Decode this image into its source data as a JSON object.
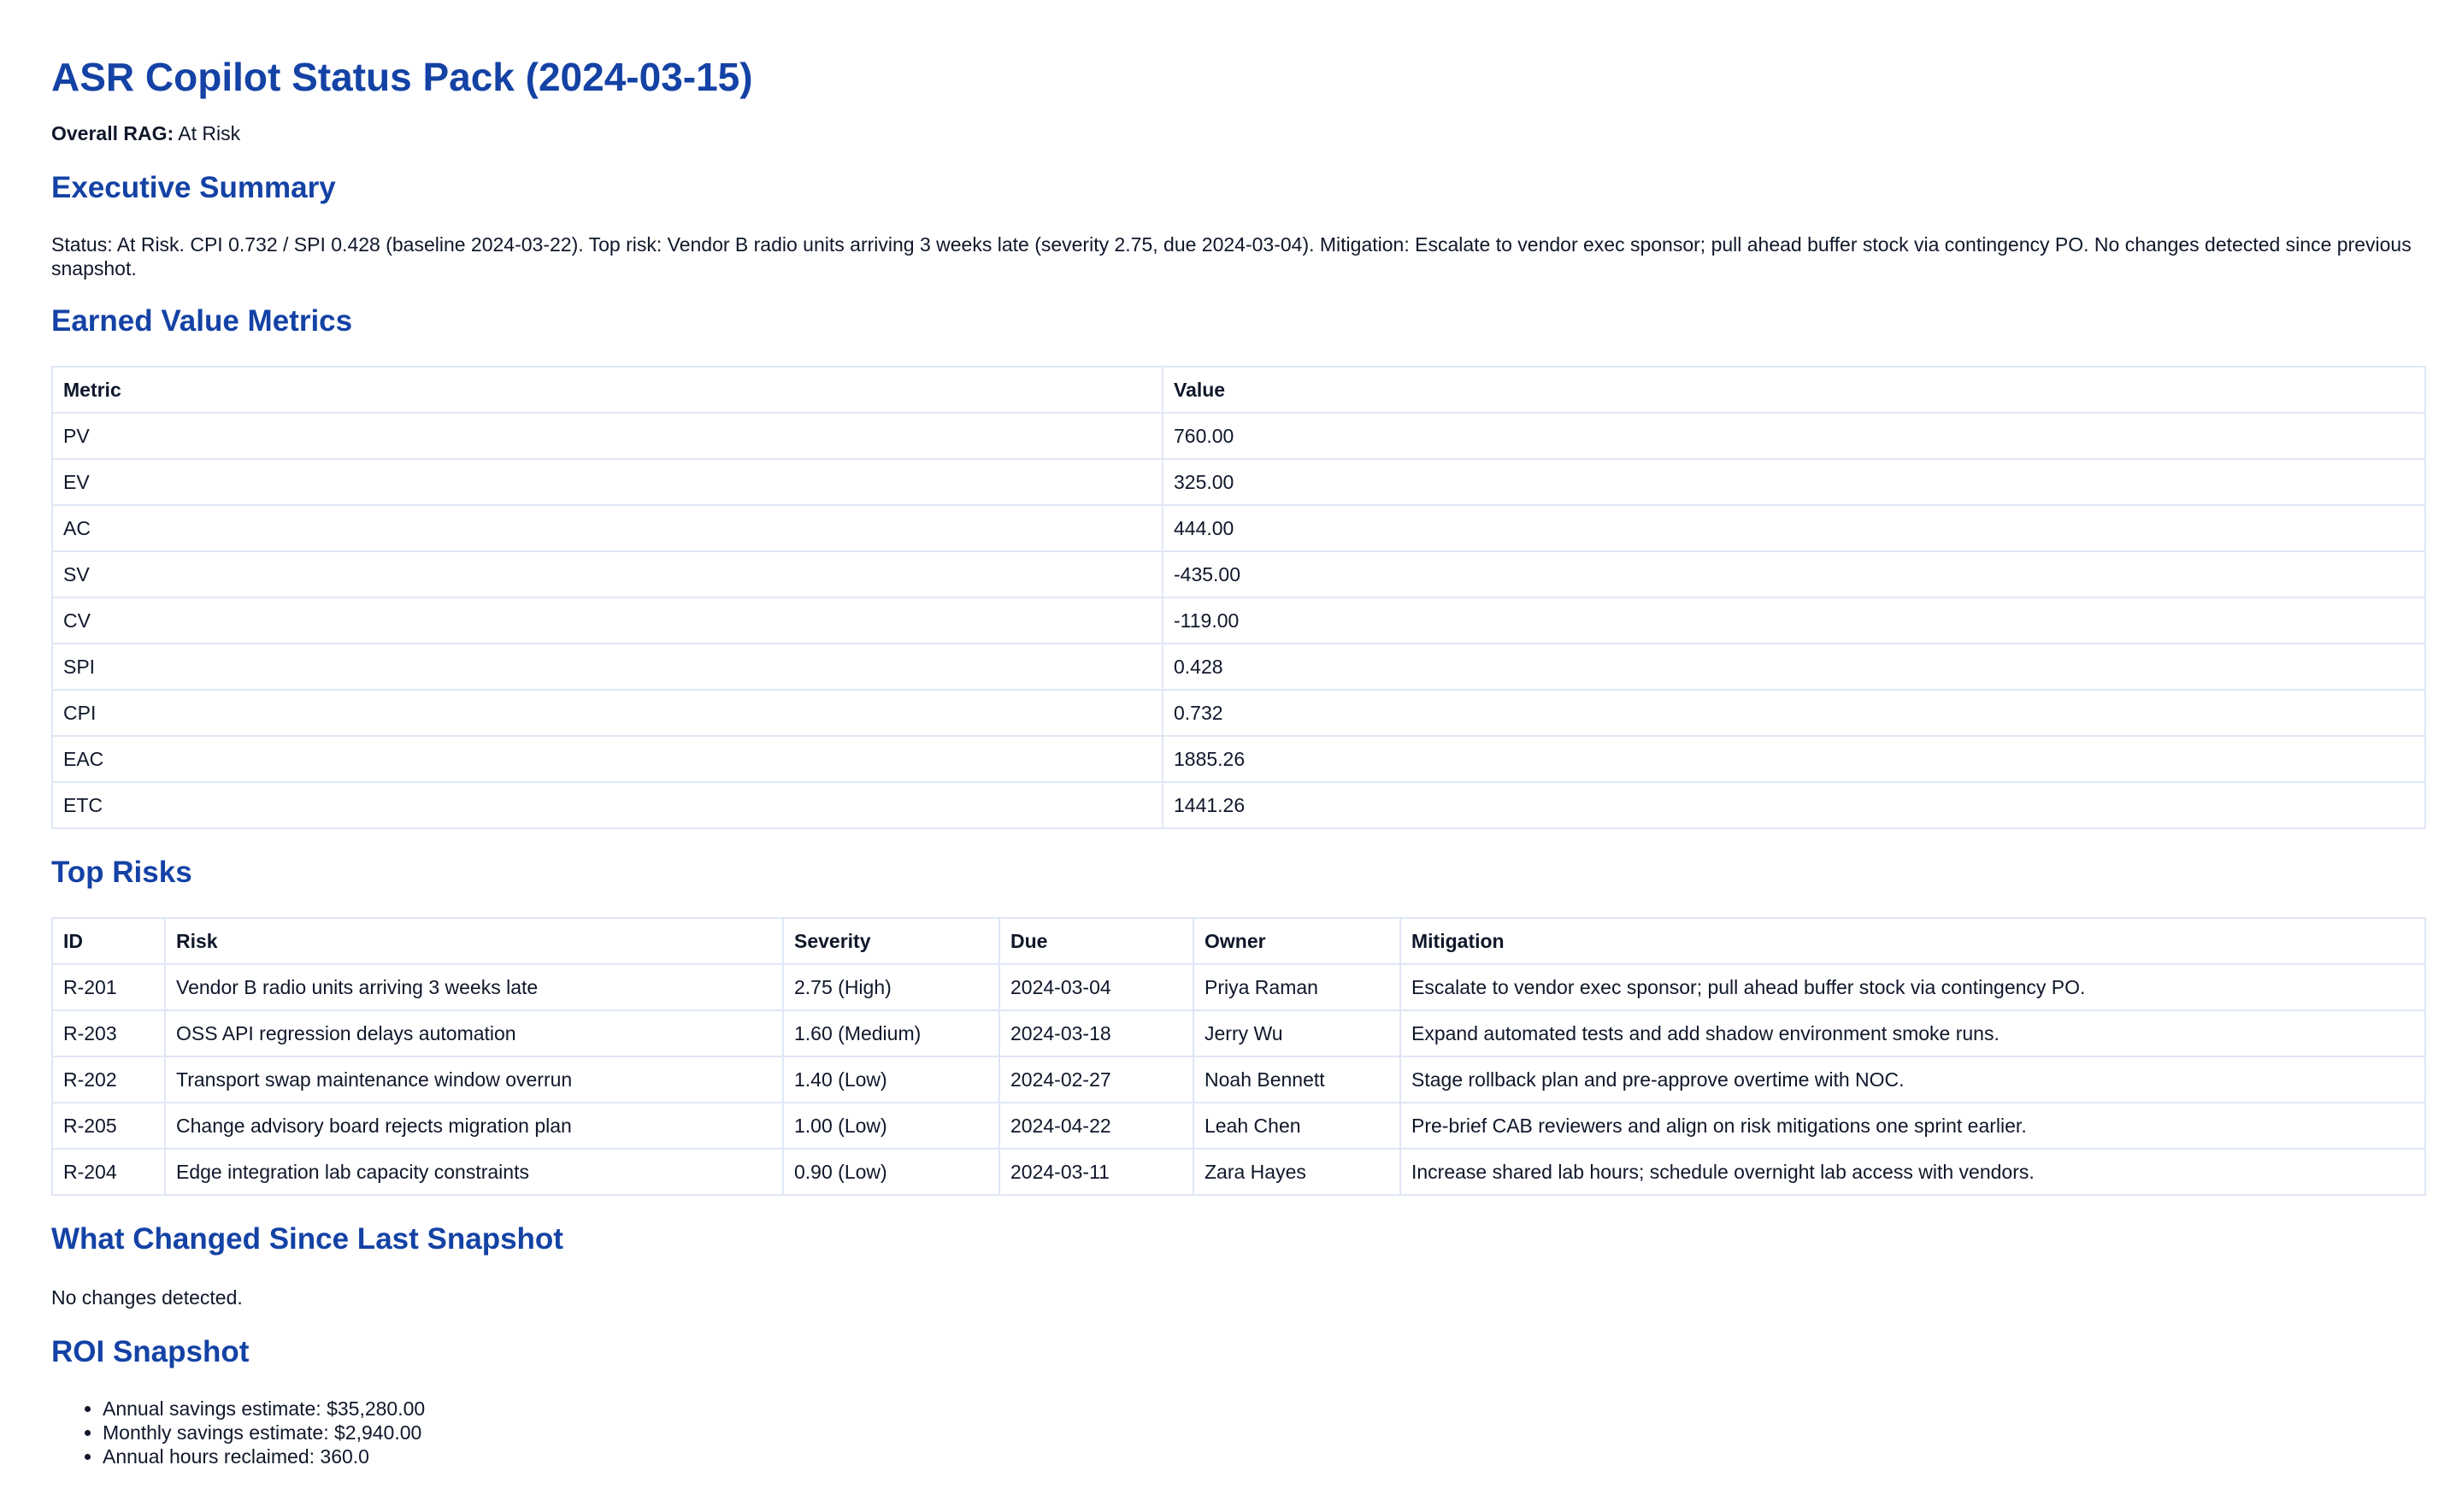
{
  "title": "ASR Copilot Status Pack (2024-03-15)",
  "overall_rag": {
    "label": "Overall RAG:",
    "value": "At Risk"
  },
  "executive_summary": {
    "heading": "Executive Summary",
    "text": "Status: At Risk. CPI 0.732 / SPI 0.428 (baseline 2024-03-22). Top risk: Vendor B radio units arriving 3 weeks late (severity 2.75, due 2024-03-04). Mitigation: Escalate to vendor exec sponsor; pull ahead buffer stock via contingency PO. No changes detected since previous snapshot."
  },
  "earned_value": {
    "heading": "Earned Value Metrics",
    "columns": [
      "Metric",
      "Value"
    ],
    "rows": [
      [
        "PV",
        "760.00"
      ],
      [
        "EV",
        "325.00"
      ],
      [
        "AC",
        "444.00"
      ],
      [
        "SV",
        "-435.00"
      ],
      [
        "CV",
        "-119.00"
      ],
      [
        "SPI",
        "0.428"
      ],
      [
        "CPI",
        "0.732"
      ],
      [
        "EAC",
        "1885.26"
      ],
      [
        "ETC",
        "1441.26"
      ]
    ]
  },
  "top_risks": {
    "heading": "Top Risks",
    "columns": [
      "ID",
      "Risk",
      "Severity",
      "Due",
      "Owner",
      "Mitigation"
    ],
    "rows": [
      [
        "R-201",
        "Vendor B radio units arriving 3 weeks late",
        "2.75 (High)",
        "2024-03-04",
        "Priya Raman",
        "Escalate to vendor exec sponsor; pull ahead buffer stock via contingency PO."
      ],
      [
        "R-203",
        "OSS API regression delays automation",
        "1.60 (Medium)",
        "2024-03-18",
        "Jerry Wu",
        "Expand automated tests and add shadow environment smoke runs."
      ],
      [
        "R-202",
        "Transport swap maintenance window overrun",
        "1.40 (Low)",
        "2024-02-27",
        "Noah Bennett",
        "Stage rollback plan and pre-approve overtime with NOC."
      ],
      [
        "R-205",
        "Change advisory board rejects migration plan",
        "1.00 (Low)",
        "2024-04-22",
        "Leah Chen",
        "Pre-brief CAB reviewers and align on risk mitigations one sprint earlier."
      ],
      [
        "R-204",
        "Edge integration lab capacity constraints",
        "0.90 (Low)",
        "2024-03-11",
        "Zara Hayes",
        "Increase shared lab hours; schedule overnight lab access with vendors."
      ]
    ]
  },
  "changes": {
    "heading": "What Changed Since Last Snapshot",
    "text": "No changes detected."
  },
  "roi": {
    "heading": "ROI Snapshot",
    "items": [
      "Annual savings estimate: $35,280.00",
      "Monthly savings estimate: $2,940.00",
      "Annual hours reclaimed: 360.0"
    ]
  },
  "colors": {
    "heading": "#1442a5",
    "text": "#0f172a",
    "table_border": "#dfe6f5"
  }
}
